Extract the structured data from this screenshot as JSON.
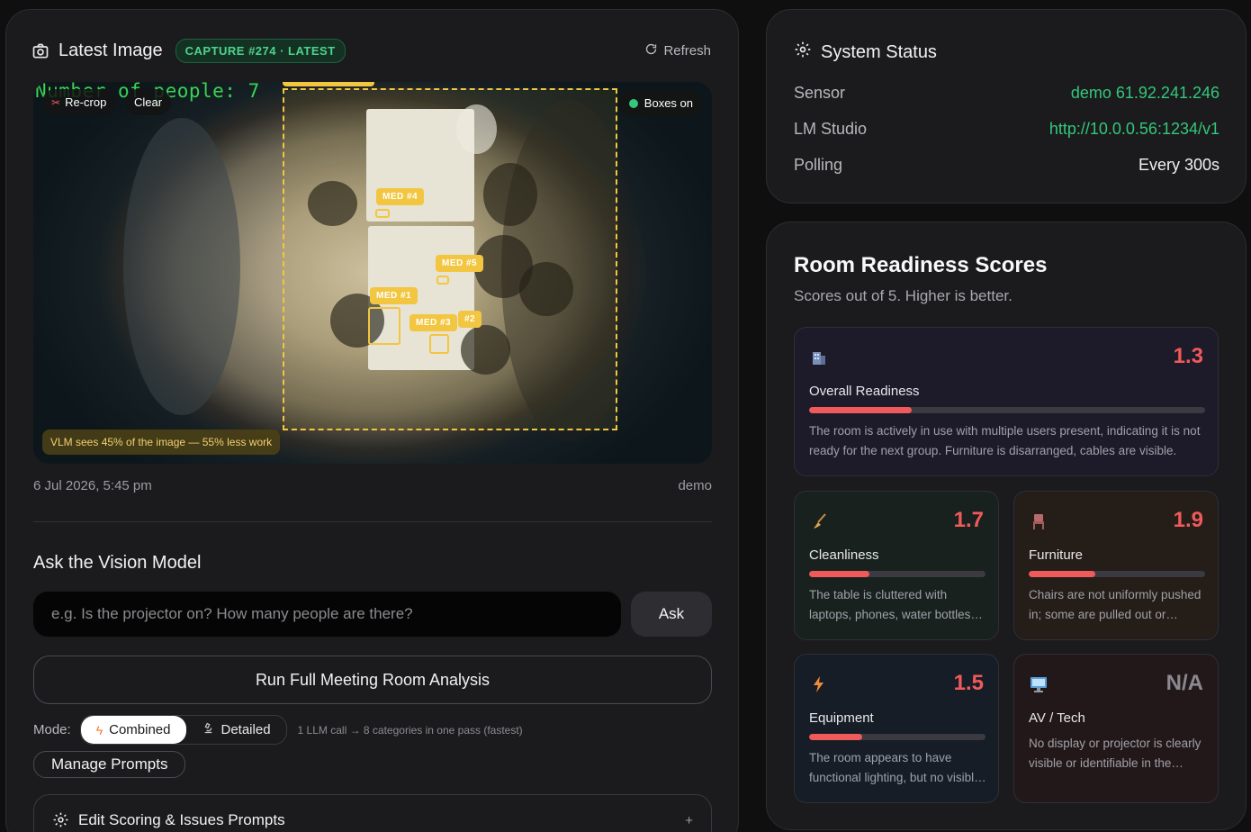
{
  "latest_image": {
    "title": "Latest Image",
    "capture_badge": "CAPTURE #274 · LATEST",
    "refresh_label": "Refresh",
    "overlay_text": "Number of people: 7",
    "recrop_label": "Re-crop",
    "clear_label": "Clear",
    "boxes_label": "Boxes on",
    "vlm_note": "VLM sees 45% of the image — 55% less work",
    "detections": [
      "MED #4",
      "MED #5",
      "MED #1",
      "MED #3",
      "#2"
    ],
    "timestamp": "6 Jul 2026, 5:45 pm",
    "source": "demo"
  },
  "ask": {
    "title": "Ask the Vision Model",
    "placeholder": "e.g. Is the projector on? How many people are there?",
    "button": "Ask",
    "run_button": "Run Full Meeting Room Analysis",
    "mode_label": "Mode:",
    "mode_combined": "Combined",
    "mode_detailed": "Detailed",
    "mode_hint": "1 LLM call → 8 categories in one pass (fastest)",
    "manage_prompts": "Manage Prompts",
    "edit_prompts": "Edit Scoring & Issues Prompts",
    "expand_symbol": "+"
  },
  "system_status": {
    "title": "System Status",
    "rows": [
      {
        "key": "Sensor",
        "value": "demo 61.92.241.246"
      },
      {
        "key": "LM Studio",
        "value": "http://10.0.0.56:1234/v1"
      },
      {
        "key": "Polling",
        "value": "Every 300s"
      }
    ]
  },
  "scores": {
    "title": "Room Readiness Scores",
    "subtitle": "Scores out of 5. Higher is better.",
    "max": 5,
    "items": [
      {
        "name": "Overall Readiness",
        "value": "1.3",
        "score": 1.3,
        "icon": "building-icon",
        "desc": "The room is actively in use with multiple users present, indicating it is not ready for the next group. Furniture is disarranged, cables are visible."
      },
      {
        "name": "Cleanliness",
        "value": "1.7",
        "score": 1.7,
        "icon": "broom-icon",
        "desc": "The table is cluttered with laptops, phones, water bottles and papers."
      },
      {
        "name": "Furniture",
        "value": "1.9",
        "score": 1.9,
        "icon": "chair-icon",
        "desc": "Chairs are not uniformly pushed in; some are pulled out or rotated."
      },
      {
        "name": "Equipment",
        "value": "1.5",
        "score": 1.5,
        "icon": "lightning-icon",
        "desc": "The room appears to have functional lighting, but no visible display."
      },
      {
        "name": "AV / Tech",
        "value": "N/A",
        "score": 0,
        "icon": "monitor-icon",
        "desc": "No display or projector is clearly visible or identifiable in the image."
      }
    ]
  },
  "colors": {
    "accent_green": "#34c77b",
    "score_red": "#f05a5a",
    "box_yellow": "#f2c640"
  }
}
